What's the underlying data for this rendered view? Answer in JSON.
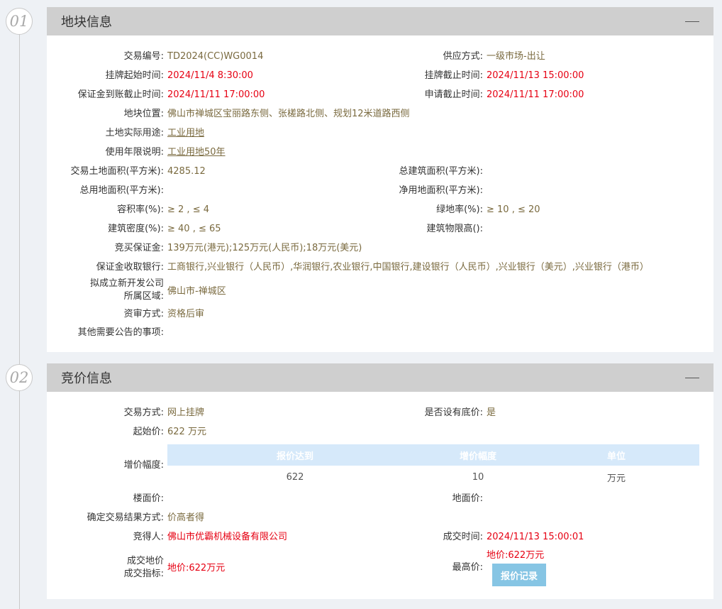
{
  "sections": {
    "land": {
      "number": "01",
      "title": "地块信息",
      "fields": {
        "trade_no": {
          "label": "交易编号:",
          "value": "TD2024(CC)WG0014"
        },
        "supply_method": {
          "label": "供应方式:",
          "value": "一级市场-出让"
        },
        "listing_start": {
          "label": "挂牌起始时间:",
          "value": "2024/11/4 8:30:00"
        },
        "listing_end": {
          "label": "挂牌截止时间:",
          "value": "2024/11/13 15:00:00"
        },
        "deposit_deadline": {
          "label": "保证金到账截止时间:",
          "value": "2024/11/11 17:00:00"
        },
        "apply_deadline": {
          "label": "申请截止时间:",
          "value": "2024/11/11 17:00:00"
        },
        "location": {
          "label": "地块位置:",
          "value": "佛山市禅城区宝丽路东侧、张槎路北侧、规划12米道路西侧"
        },
        "land_use": {
          "label": "土地实际用途:",
          "value": "工业用地"
        },
        "term": {
          "label": "使用年限说明:",
          "value": "工业用地50年"
        },
        "land_area": {
          "label": "交易土地面积(平方米):",
          "value": "4285.12"
        },
        "building_area": {
          "label": "总建筑面积(平方米):",
          "value": ""
        },
        "total_use_area": {
          "label": "总用地面积(平方米):",
          "value": ""
        },
        "net_use_area": {
          "label": "净用地面积(平方米):",
          "value": ""
        },
        "plot_ratio": {
          "label": "容积率(%):",
          "value": "≥ 2 , ≤ 4"
        },
        "green_ratio": {
          "label": "绿地率(%):",
          "value": "≥ 10 , ≤ 20"
        },
        "density": {
          "label": "建筑密度(%):",
          "value": "≥ 40 , ≤ 65"
        },
        "height_limit": {
          "label": "建筑物限高():",
          "value": ""
        },
        "bid_deposit": {
          "label": "竞买保证金:",
          "value": "139万元(港元);125万元(人民币);18万元(美元)"
        },
        "banks": {
          "label": "保证金收取银行:",
          "value": "工商银行,兴业银行（人民币）,华润银行,农业银行,中国银行,建设银行（人民币）,兴业银行（美元）,兴业银行（港币）"
        },
        "new_company_line1": {
          "label": "拟成立新开发公司",
          "value": ""
        },
        "new_company_line2": {
          "label": "所属区域:",
          "value": "佛山市-禅城区"
        },
        "review": {
          "label": "资审方式:",
          "value": "资格后审"
        },
        "other": {
          "label": "其他需要公告的事项:",
          "value": ""
        }
      }
    },
    "bidding": {
      "number": "02",
      "title": "竞价信息",
      "fields": {
        "trade_method": {
          "label": "交易方式:",
          "value": "网上挂牌"
        },
        "reserve": {
          "label": "是否设有底价:",
          "value": "是"
        },
        "start_price": {
          "label": "起始价:",
          "value": "622 万元"
        },
        "increment": {
          "label": "增价幅度:"
        },
        "floor_price": {
          "label": "楼面价:",
          "value": ""
        },
        "land_price": {
          "label": "地面价:",
          "value": ""
        },
        "result_method": {
          "label": "确定交易结果方式:",
          "value": "价高者得"
        },
        "winner": {
          "label": "竞得人:",
          "value": "佛山市优霸机械设备有限公司"
        },
        "deal_time": {
          "label": "成交时间:",
          "value": "2024/11/13 15:00:01"
        },
        "deal_price_line1": {
          "label": "成交地价",
          "value": ""
        },
        "deal_price_line2": {
          "label": "成交指标:",
          "value": "地价:622万元"
        },
        "highest": {
          "label": "最高价:",
          "value": "地价:622万元"
        }
      },
      "table": {
        "headers": [
          "报价达到",
          "增价幅度",
          "单位"
        ],
        "row": [
          "622",
          "10",
          "万元"
        ]
      },
      "record_button": "报价记录"
    }
  }
}
